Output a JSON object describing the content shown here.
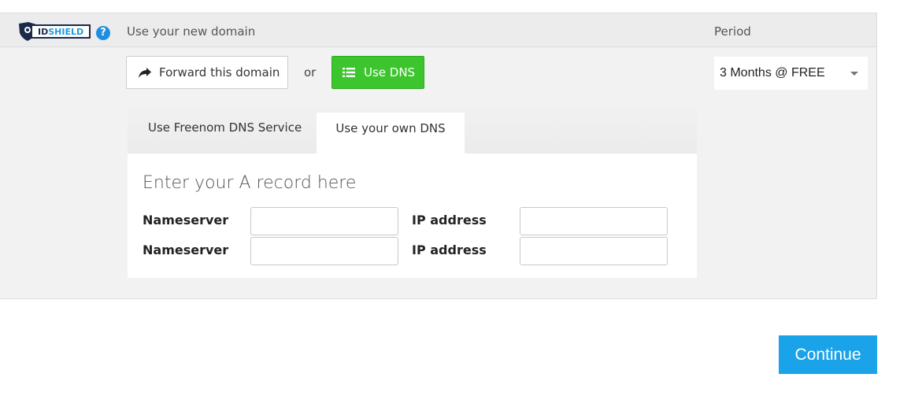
{
  "header": {
    "logo_text": "IDSHIELD",
    "help_icon": "question-circle-icon",
    "title": "Use your new domain",
    "period_label": "Period"
  },
  "actions": {
    "forward_label": "Forward this domain",
    "forward_icon": "share-arrow-icon",
    "or_text": "or",
    "dns_label": "Use DNS",
    "dns_icon": "list-icon"
  },
  "period": {
    "selected": "3 Months @ FREE"
  },
  "dns_tabs": {
    "freenom": "Use Freenom DNS Service",
    "own": "Use your own DNS",
    "active": "own"
  },
  "record_form": {
    "title": "Enter your A record here",
    "rows": [
      {
        "nameserver_label": "Nameserver",
        "nameserver_value": "",
        "ip_label": "IP address",
        "ip_value": ""
      },
      {
        "nameserver_label": "Nameserver",
        "nameserver_value": "",
        "ip_label": "IP address",
        "ip_value": ""
      }
    ]
  },
  "footer": {
    "continue_label": "Continue"
  },
  "colors": {
    "dns_green": "#3cc52c",
    "continue_blue": "#1aa3e8",
    "help_blue": "#1e8fe0",
    "logo_navy": "#1b2a4a"
  }
}
